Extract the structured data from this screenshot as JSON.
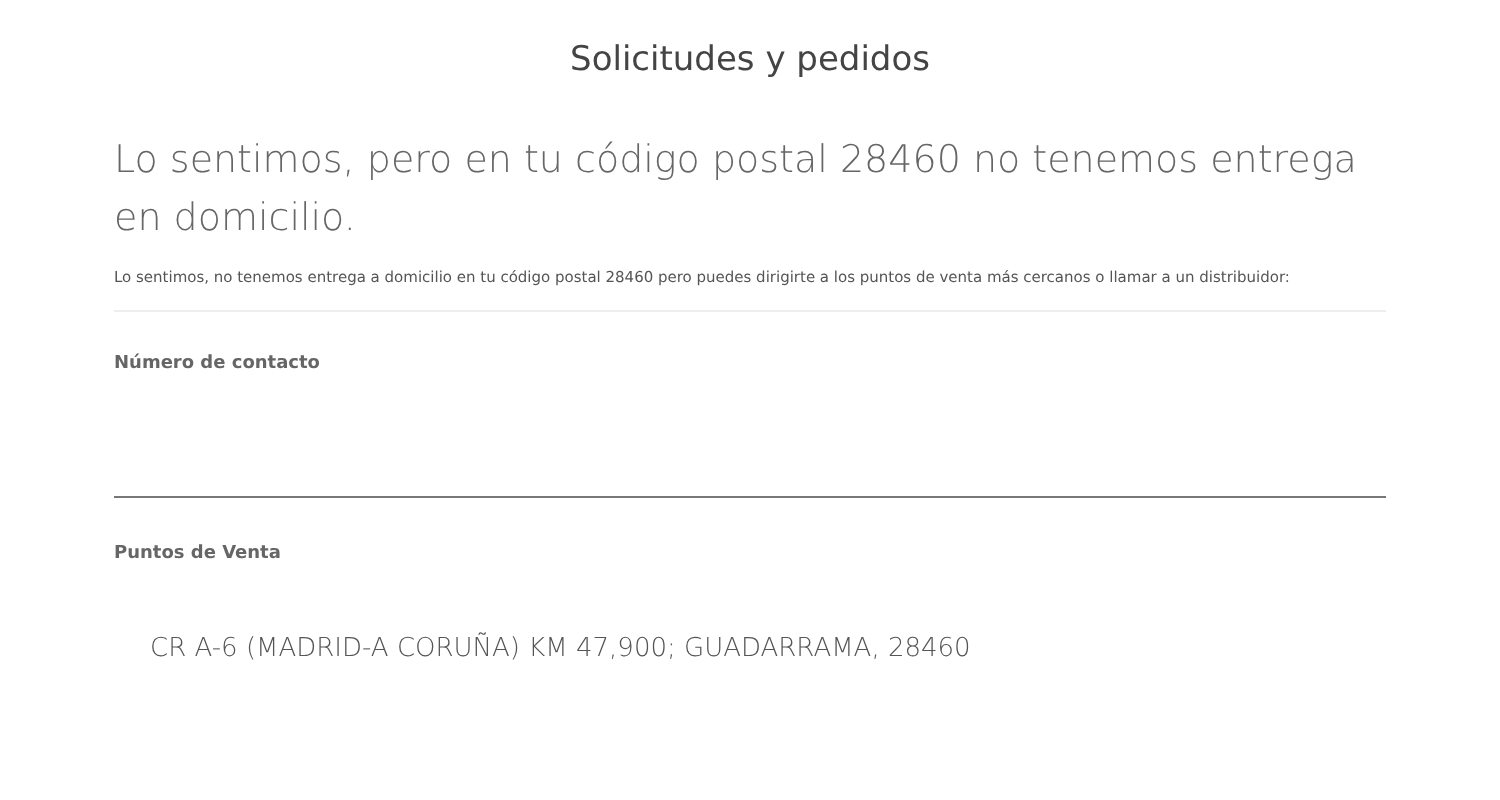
{
  "page_title": "Solicitudes y pedidos",
  "heading": "Lo sentimos, pero en tu código postal 28460 no tenemos entrega en domicilio.",
  "description": "Lo sentimos, no tenemos entrega a domicilio en tu código postal 28460 pero puedes dirigirte a los puntos de venta más cercanos o llamar a un distribuidor:",
  "contact": {
    "label": "Número de contacto"
  },
  "points_of_sale": {
    "label": "Puntos de Venta",
    "items": [
      "CR A-6 (MADRID-A CORUÑA) KM 47,900; GUADARRAMA, 28460"
    ]
  }
}
